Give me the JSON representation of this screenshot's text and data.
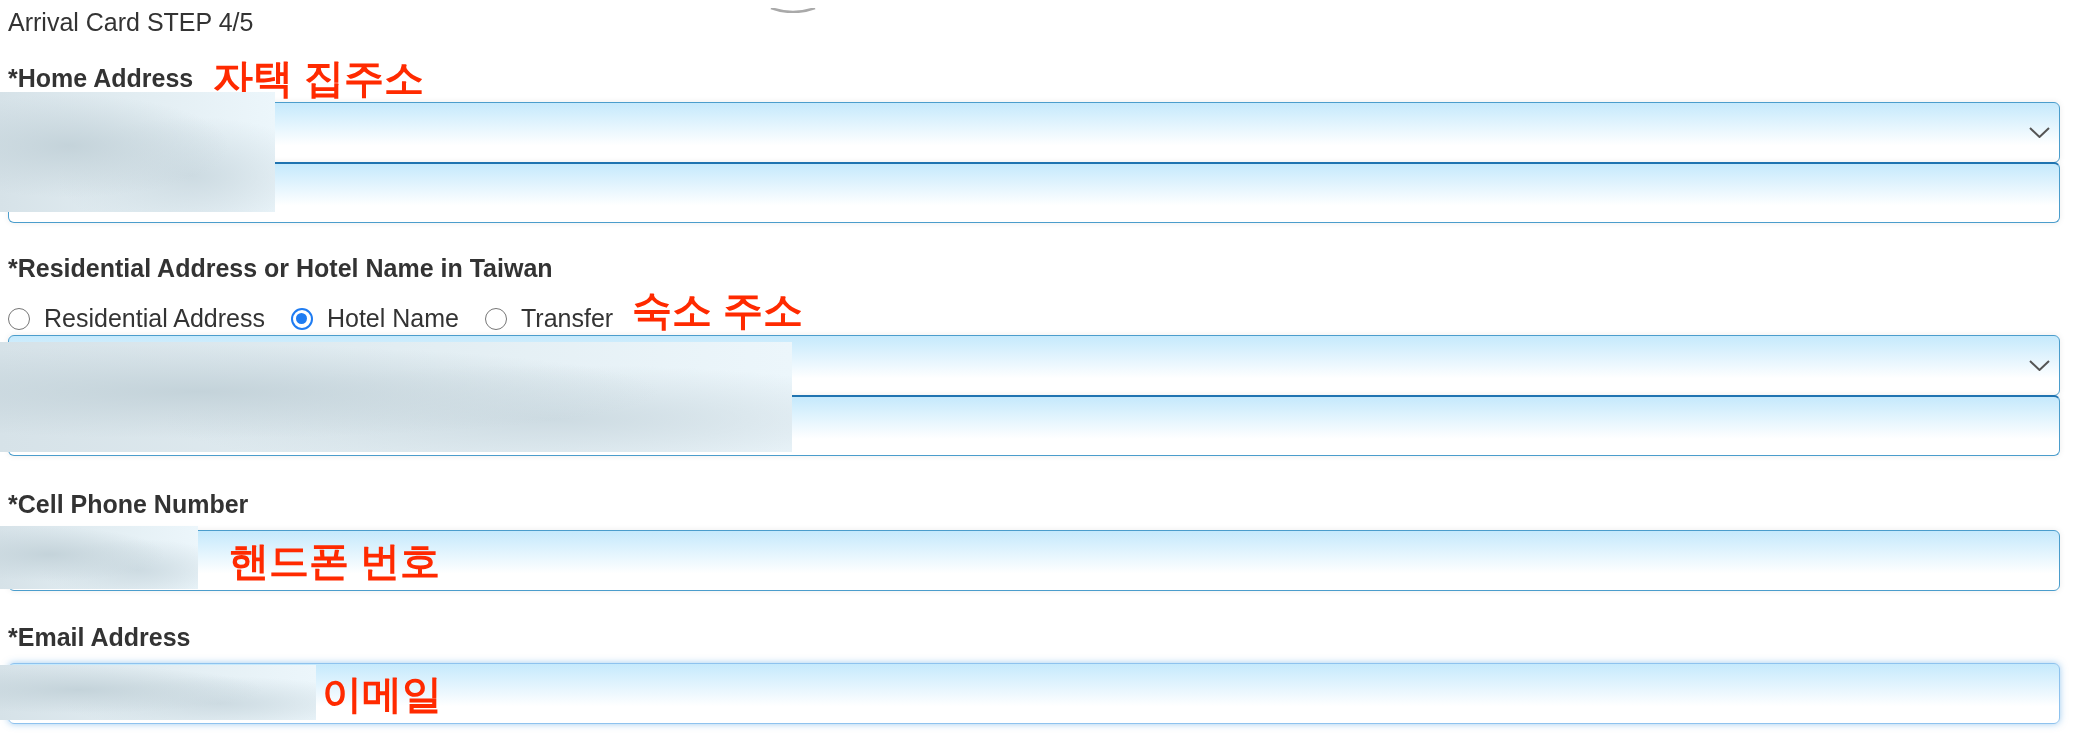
{
  "header": {
    "title": "Arrival Card STEP 4/5"
  },
  "sections": [
    {
      "label": "*Home Address",
      "annotation": "자택 집주소",
      "redacted": true,
      "fields": [
        {
          "kind": "select",
          "focused": false
        },
        {
          "kind": "text",
          "focused": false
        }
      ]
    },
    {
      "label": "*Residential Address or Hotel Name in Taiwan",
      "options": [
        {
          "label": "Residential Address",
          "selected": false
        },
        {
          "label": "Hotel Name",
          "selected": true
        },
        {
          "label": "Transfer",
          "selected": false
        }
      ],
      "annotation": "숙소 주소",
      "redacted": true,
      "fields": [
        {
          "kind": "select",
          "focused": false
        },
        {
          "kind": "text",
          "focused": false
        }
      ]
    },
    {
      "label": "*Cell Phone Number",
      "annotation": "핸드폰 번호",
      "redacted": true,
      "fields": [
        {
          "kind": "text",
          "focused": false
        }
      ]
    },
    {
      "label": "*Email Address",
      "annotation": "이메일",
      "redacted": true,
      "fields": [
        {
          "kind": "text",
          "focused": true
        }
      ]
    }
  ]
}
